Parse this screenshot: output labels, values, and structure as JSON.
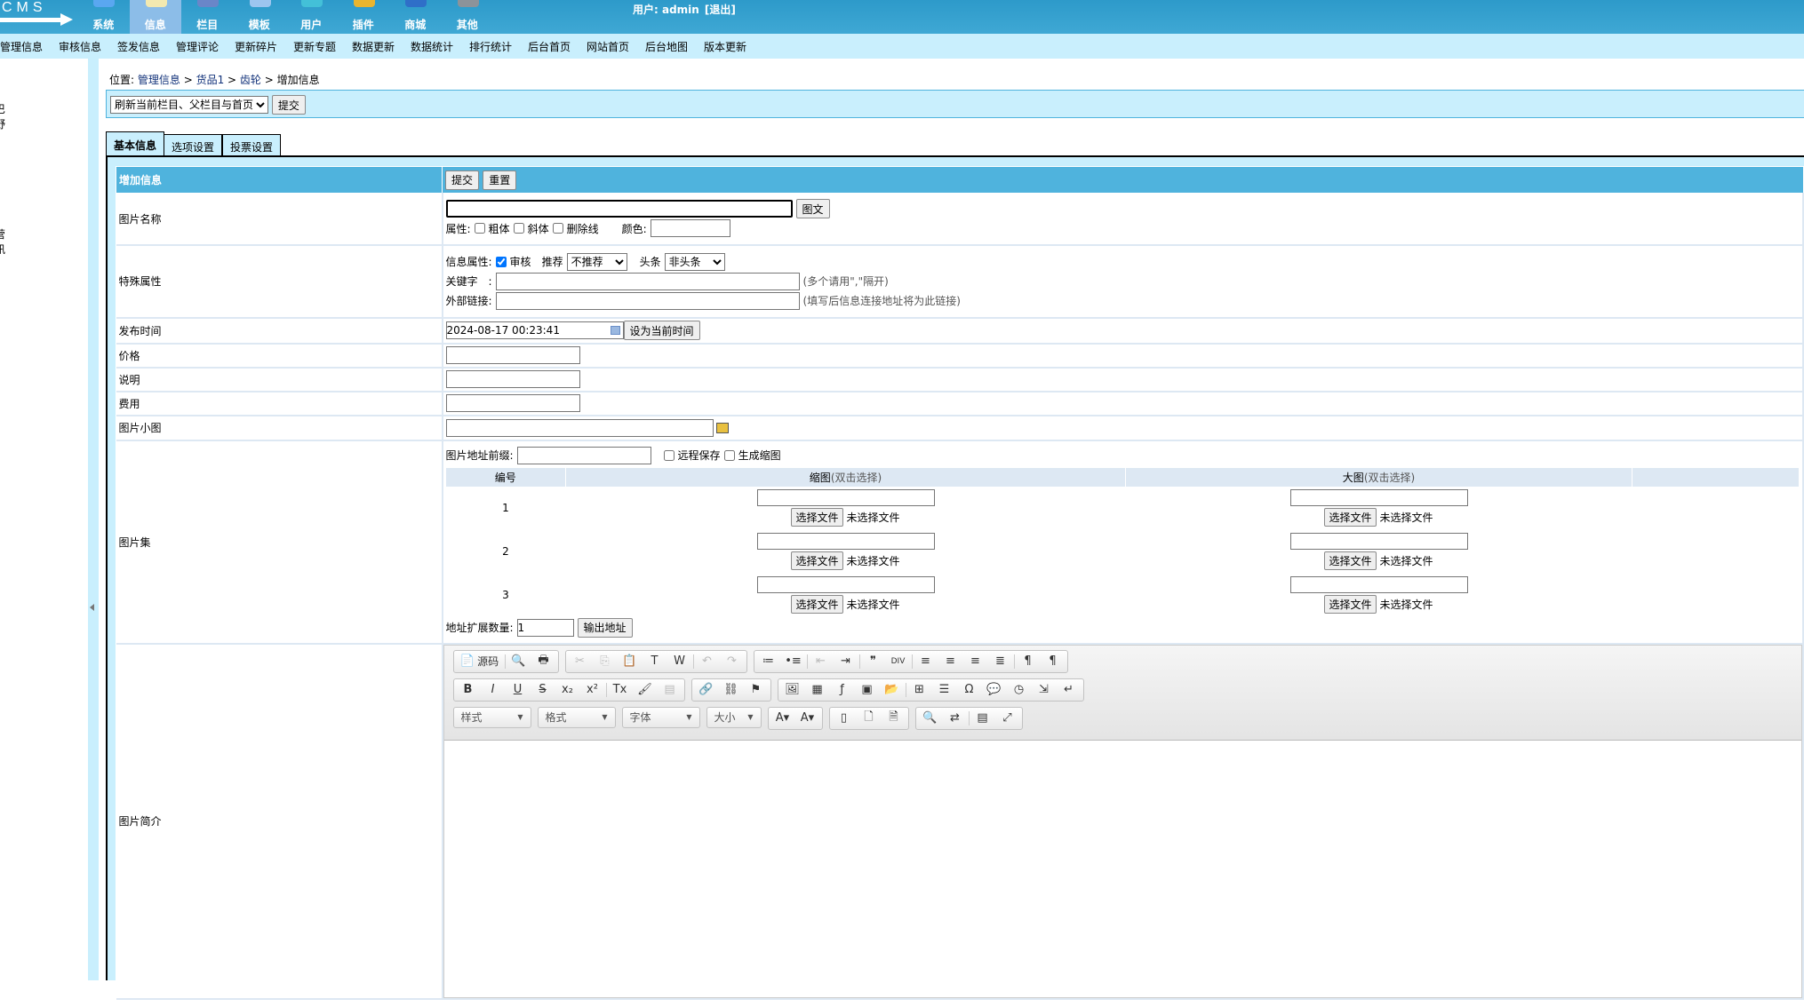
{
  "logo": "CMS",
  "nav": [
    {
      "label": "系统",
      "icon": "shield-globe-icon",
      "color": "#5aa7f0",
      "active": false
    },
    {
      "label": "信息",
      "icon": "notepad-pencil-icon",
      "color": "#f3e9b0",
      "active": true
    },
    {
      "label": "栏目",
      "icon": "list-window-icon",
      "color": "#6a86c8",
      "active": false
    },
    {
      "label": "模板",
      "icon": "window-icon",
      "color": "#9dc5ef",
      "active": false
    },
    {
      "label": "用户",
      "icon": "user-icon",
      "color": "#43c0d8",
      "active": false
    },
    {
      "label": "插件",
      "icon": "tools-icon",
      "color": "#e9b52e",
      "active": false
    },
    {
      "label": "商城",
      "icon": "shop-card-icon",
      "color": "#2f6fc8",
      "active": false
    },
    {
      "label": "其他",
      "icon": "gear-icon",
      "color": "#8c939a",
      "active": false
    }
  ],
  "user": {
    "prefix": "用户: ",
    "name": "admin",
    "logout": "[退出]"
  },
  "menu": [
    "管理信息",
    "审核信息",
    "签发信息",
    "管理评论",
    "更新碎片",
    "更新专题",
    "数据更新",
    "数据统计",
    "排行统计",
    "后台首页",
    "网站首页",
    "后台地图",
    "版本更新"
  ],
  "sidebar_fragments": [
    "巴",
    "野",
    "营",
    "讯"
  ],
  "breadcrumb": {
    "prefix": "位置: ",
    "items": [
      "管理信息",
      "货品1",
      "齿轮"
    ],
    "sep": " > ",
    "current": "增加信息"
  },
  "refresh": {
    "selected": "刷新当前栏目、父栏目与首页",
    "submit": "提交"
  },
  "tabs": [
    "基本信息",
    "选项设置",
    "投票设置"
  ],
  "form": {
    "header": "增加信息",
    "submit": "提交",
    "reset": "重置",
    "title_label": "图片名称",
    "title_value": "",
    "title_btn": "图文",
    "attr_label": "属性:",
    "bold": "粗体",
    "italic": "斜体",
    "strike": "删除线",
    "color_label": "颜色:",
    "color_value": "",
    "special_label": "特殊属性",
    "info_attr": "信息属性:",
    "check": "审核",
    "check_checked": true,
    "recommend_label": "推荐",
    "recommend": "不推荐",
    "headline_label": "头条",
    "headline": "非头条",
    "keywords_label": "关键字　:",
    "keywords_hint": "(多个请用\",\"隔开)",
    "link_label": "外部链接:",
    "link_hint": "(填写后信息连接地址将为此链接)",
    "time_label": "发布时间",
    "time_value": "2024-08-17 00:23:41",
    "time_btn": "设为当前时间",
    "price_label": "价格",
    "desc_label": "说明",
    "fee_label": "费用",
    "thumb_label": "图片小图",
    "gallery_label": "图片集",
    "prefix_label": "图片地址前缀:",
    "remote_save": "远程保存",
    "make_thumb": "生成缩图",
    "gallery_cols": [
      "编号",
      "缩图",
      "大图"
    ],
    "dbl_hint": "(双击选择)",
    "gallery_rows": [
      "1",
      "2",
      "3"
    ],
    "choose_file": "选择文件",
    "no_file": "未选择文件",
    "expand_label": "地址扩展数量:",
    "expand_value": "1",
    "export_btn": "输出地址",
    "intro_label": "图片简介"
  },
  "editor": {
    "source": "源码",
    "combos": [
      "样式",
      "格式",
      "字体",
      "大小"
    ]
  }
}
